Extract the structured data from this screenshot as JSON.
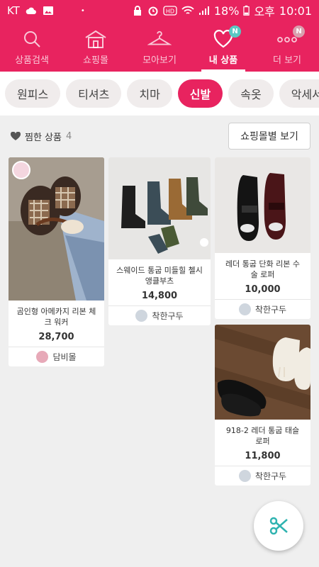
{
  "status_bar": {
    "carrier": "KT",
    "battery": "18%",
    "ampm": "오후",
    "time": "10:01"
  },
  "nav": {
    "items": [
      {
        "label": "상품검색",
        "icon": "search-icon"
      },
      {
        "label": "쇼핑몰",
        "icon": "store-icon"
      },
      {
        "label": "모아보기",
        "icon": "hanger-icon"
      },
      {
        "label": "내 상품",
        "icon": "heart-icon",
        "badge": "N"
      },
      {
        "label": "더 보기",
        "icon": "more-icon",
        "badge": "N"
      }
    ],
    "active_index": 3
  },
  "categories": [
    "원피스",
    "티셔츠",
    "치마",
    "신발",
    "속옷",
    "악세서리"
  ],
  "active_category": "신발",
  "favorites": {
    "label": "찜한 상품",
    "count": "4",
    "view_button": "쇼핑몰별 보기"
  },
  "products": [
    {
      "name": "곰인형 아메카지 리본 체크 워커",
      "price": "28,700",
      "shop": "담비몰"
    },
    {
      "name": "스웨이드 통굽 미들힐 첼시 앵클부츠",
      "price": "14,800",
      "shop": "착한구두"
    },
    {
      "name": "레더 통굽 단화 리본 수술 로퍼",
      "price": "10,000",
      "shop": "착한구두"
    },
    {
      "name": "918-2 레더 통굽 태슬 로퍼",
      "price": "11,800",
      "shop": "착한구두"
    }
  ],
  "colors": {
    "accent": "#e8235f",
    "badge": "#5bc8c3",
    "fab_icon": "#2fb3b0"
  }
}
